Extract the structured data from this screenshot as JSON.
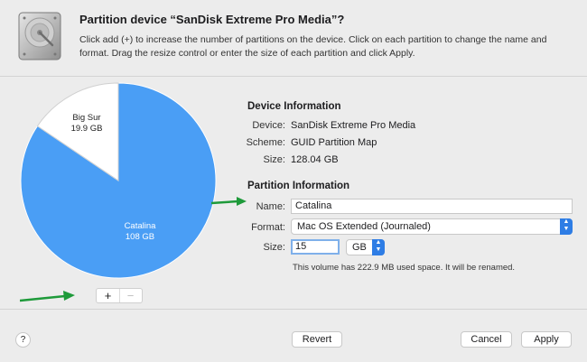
{
  "header": {
    "title": "Partition device “SanDisk Extreme Pro Media”?",
    "description": "Click add (+) to increase the number of partitions on the device. Click on each partition to change the name and format. Drag the resize control or enter the size of each partition and click Apply."
  },
  "pie": {
    "slices": [
      {
        "name": "Big Sur",
        "size_label": "19.9 GB",
        "value_gb": 19.9,
        "color": "#ffffff"
      },
      {
        "name": "Catalina",
        "size_label": "108 GB",
        "value_gb": 108,
        "color": "#4a9ef5"
      }
    ]
  },
  "device_info": {
    "title": "Device Information",
    "device_label": "Device:",
    "device_value": "SanDisk Extreme Pro Media",
    "scheme_label": "Scheme:",
    "scheme_value": "GUID Partition Map",
    "size_label": "Size:",
    "size_value": "128.04 GB"
  },
  "partition_info": {
    "title": "Partition Information",
    "name_label": "Name:",
    "name_value": "Catalina",
    "format_label": "Format:",
    "format_value": "Mac OS Extended (Journaled)",
    "size_label": "Size:",
    "size_value": "15",
    "unit_value": "GB",
    "note": "This volume has 222.9 MB used space. It will be renamed."
  },
  "partition_controls": {
    "add_label": "+",
    "remove_label": "−"
  },
  "footer": {
    "help_label": "?",
    "revert_label": "Revert",
    "cancel_label": "Cancel",
    "apply_label": "Apply"
  },
  "colors": {
    "accent": "#2e7de5",
    "pie_blue": "#4a9ef5",
    "arrow_green": "#1e9a3a"
  },
  "icons": [
    "hard-disk-icon",
    "up-down-chevron-icon",
    "help-icon",
    "green-arrow-icon"
  ]
}
